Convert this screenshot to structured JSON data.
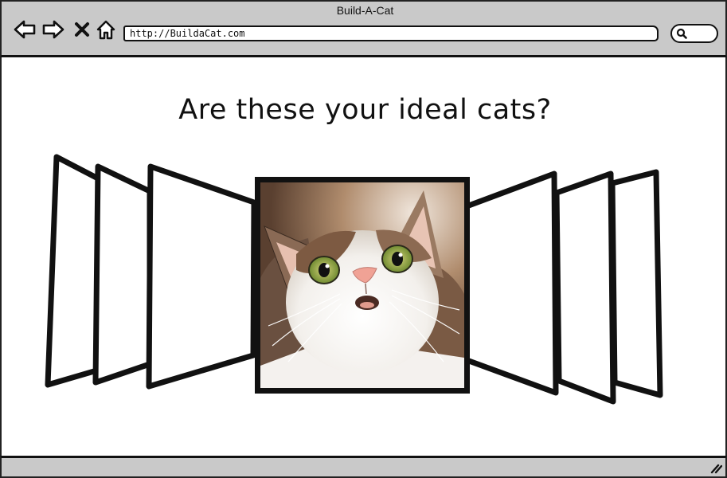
{
  "window": {
    "title": "Build-A-Cat"
  },
  "toolbar": {
    "back_icon": "back-arrow-icon",
    "forward_icon": "forward-arrow-icon",
    "stop_icon": "close-icon",
    "home_icon": "home-icon",
    "search_icon": "search-icon"
  },
  "address_bar": {
    "url": "http://BuildaCat.com"
  },
  "page": {
    "heading": "Are these your ideal cats?"
  },
  "carousel": {
    "featured_image": "surprised cat photo",
    "left_panels": 3,
    "right_panels": 3
  },
  "statusbar": {
    "grip_icon": "resize-grip-icon"
  },
  "colors": {
    "chrome": "#c9c9c9",
    "ink": "#111111",
    "page": "#ffffff"
  }
}
